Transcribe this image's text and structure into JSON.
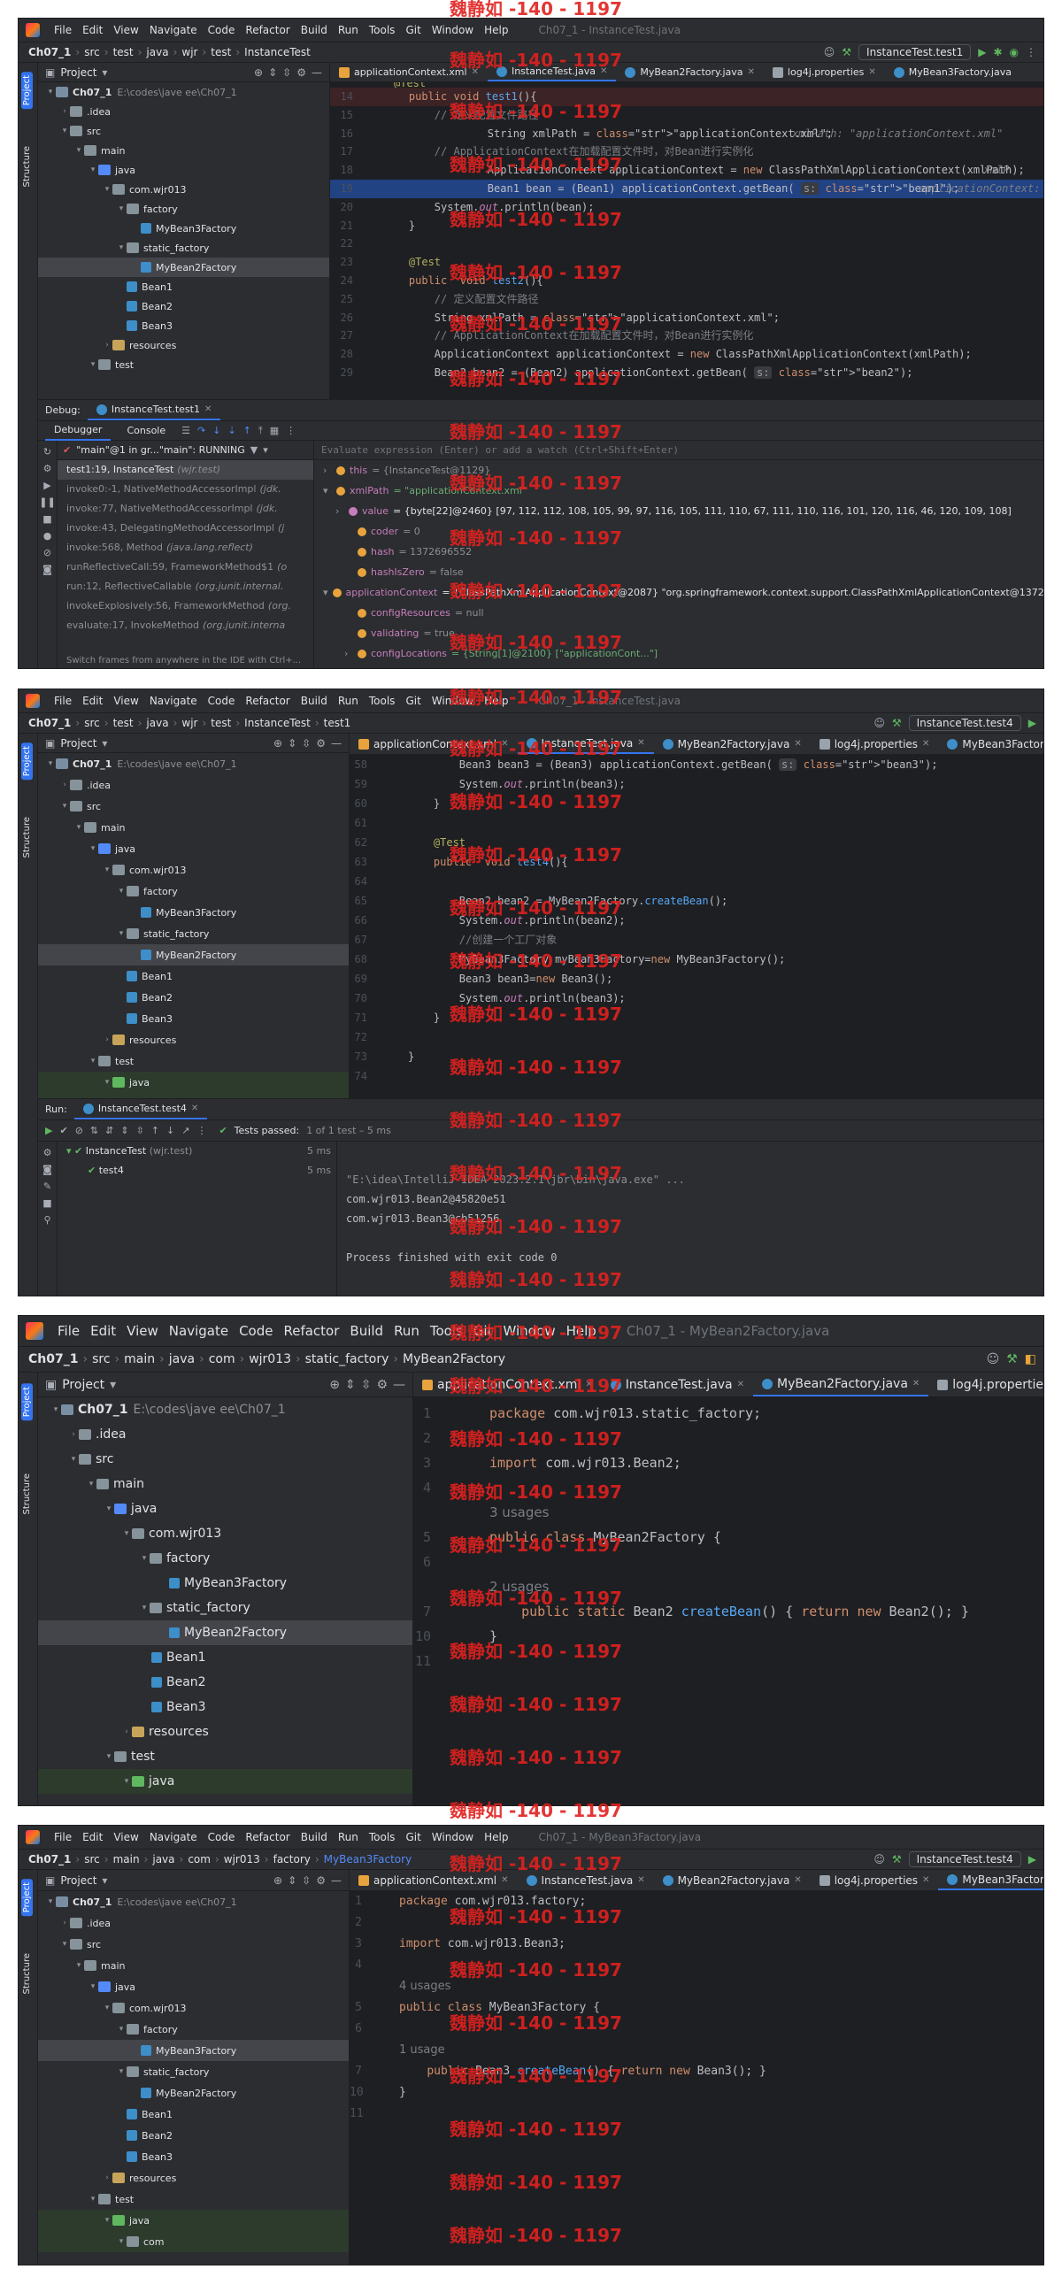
{
  "menu": [
    "File",
    "Edit",
    "View",
    "Navigate",
    "Code",
    "Refactor",
    "Build",
    "Run",
    "Tools",
    "Git",
    "Window",
    "Help"
  ],
  "watermark": "魏静如 -140 - 1197",
  "project_header": "Project",
  "strip_labels": {
    "project": "Project",
    "structure": "Structure",
    "bookmarks": "Bookmarks"
  },
  "tree_labels": {
    "root": "Ch07_1",
    "root_path": "E:\\codes\\jave ee\\Ch07_1",
    "idea": ".idea",
    "src": "src",
    "main": "main",
    "java": "java",
    "pkg": "com.wjr013",
    "factory": "factory",
    "mb3": "MyBean3Factory",
    "static_factory": "static_factory",
    "mb2": "MyBean2Factory",
    "bean1": "Bean1",
    "bean2": "Bean2",
    "bean3": "Bean3",
    "resources": "resources",
    "test": "test",
    "com": "com"
  },
  "tabs": {
    "ctx": "applicationContext.xml",
    "it": "InstanceTest.java",
    "mb2": "MyBean2Factory.java",
    "log4j": "log4j.properties",
    "mb3": "MyBean3Factory.java"
  },
  "panel1": {
    "title": "Ch07_1 - InstanceTest.java",
    "crumbs": [
      "Ch07_1",
      "src",
      "test",
      "java",
      "wjr",
      "test",
      "InstanceTest"
    ],
    "runcfg": "InstanceTest.test1",
    "lines": [
      {
        "n": "14",
        "t": "    public void test1(){"
      },
      {
        "n": "15",
        "t": "        // 定义配置文件路径"
      },
      {
        "n": "16",
        "t": "        String xmlPath = \"applicationContext.xml\";",
        "h": "xmlPath: \"applicationContext.xml\""
      },
      {
        "n": "17",
        "t": "        // ApplicationContext在加载配置文件时，对Bean进行实例化"
      },
      {
        "n": "18",
        "t": "        ApplicationContext applicationContext = new ClassPathXmlApplicationContext(xmlPath);",
        "h": "xmlP"
      },
      {
        "n": "19",
        "t": "        Bean1 bean = (Bean1) applicationContext.getBean( s: \"bean1\");",
        "h": "applicationContext: \"org.spr"
      },
      {
        "n": "20",
        "t": "        System.out.println(bean);"
      },
      {
        "n": "21",
        "t": "    }"
      },
      {
        "n": "22",
        "t": ""
      },
      {
        "n": "23",
        "t": "    @Test"
      },
      {
        "n": "24",
        "t": "    public  void test2(){"
      },
      {
        "n": "25",
        "t": "        // 定义配置文件路径"
      },
      {
        "n": "26",
        "t": "        String xmlPath = \"applicationContext.xml\";"
      },
      {
        "n": "27",
        "t": "        // ApplicationContext在加载配置文件时，对Bean进行实例化"
      },
      {
        "n": "28",
        "t": "        ApplicationContext applicationContext = new ClassPathXmlApplicationContext(xmlPath);"
      },
      {
        "n": "29",
        "t": "        Bean2 bean2 = (Bean2) applicationContext.getBean( s: \"bean2\");"
      }
    ],
    "test_anno": "@Test",
    "debug_label": "Debug:",
    "debug_tab": "InstanceTest.test1",
    "debugger": "Debugger",
    "console": "Console",
    "thread": "\"main\"@1 in gr...\"main\": RUNNING",
    "eval": "Evaluate expression (Enter) or add a watch (Ctrl+Shift+Enter)",
    "frames": [
      {
        "t": "test1:19, InstanceTest",
        "c": "(wjr.test)"
      },
      {
        "t": "invoke0:-1, NativeMethodAccessorImpl",
        "c": "(jdk."
      },
      {
        "t": "invoke:77, NativeMethodAccessorImpl",
        "c": "(jdk."
      },
      {
        "t": "invoke:43, DelegatingMethodAccessorImpl",
        "c": "(j"
      },
      {
        "t": "invoke:568, Method",
        "c": "(java.lang.reflect)"
      },
      {
        "t": "runReflectiveCall:59, FrameworkMethod$1",
        "c": "(o"
      },
      {
        "t": "run:12, ReflectiveCallable",
        "c": "(org.junit.internal."
      },
      {
        "t": "invokeExplosively:56, FrameworkMethod",
        "c": "(org."
      },
      {
        "t": "evaluate:17, InvokeMethod",
        "c": "(org.junit.interna"
      }
    ],
    "frames_hint": "Switch frames from anywhere in the IDE with Ctrl+...",
    "vars": [
      {
        "n": "this",
        "v": "= {InstanceTest@1129}"
      },
      {
        "n": "xmlPath",
        "v": "= \"applicationContext.xml\""
      },
      {
        "n": "value",
        "v": "= {byte[22]@2460} [97, 112, 112, 108, 105, 99, 97, 116, 105, 111, 110, 67, 111, 110, 116, 101, 120, 116, 46, 120, 109, 108]"
      },
      {
        "n": "coder",
        "v": "= 0"
      },
      {
        "n": "hash",
        "v": "= 1372696552"
      },
      {
        "n": "hashIsZero",
        "v": "= false"
      },
      {
        "n": "applicationContext",
        "v": "= {ClassPathXmlApplicationContext@2087} \"org.springframework.context.support.ClassPathXmlApplicationContext@1372ed"
      },
      {
        "n": "configResources",
        "v": "= null"
      },
      {
        "n": "validating",
        "v": "= true"
      },
      {
        "n": "configLocations",
        "v": "= {String[1]@2100} [\"applicationCont...\"]"
      }
    ]
  },
  "panel2": {
    "title": "Ch07_1 - InstanceTest.java",
    "crumbs": [
      "Ch07_1",
      "src",
      "test",
      "java",
      "wjr",
      "test",
      "InstanceTest",
      "test1"
    ],
    "runcfg": "InstanceTest.test4",
    "lines": [
      {
        "n": "58",
        "t": "        Bean3 bean3 = (Bean3) applicationContext.getBean( s: \"bean3\");"
      },
      {
        "n": "59",
        "t": "        System.out.println(bean3);"
      },
      {
        "n": "60",
        "t": "    }"
      },
      {
        "n": "61",
        "t": ""
      },
      {
        "n": "62",
        "t": "    @Test"
      },
      {
        "n": "63",
        "t": "    public  void test4(){"
      },
      {
        "n": "64",
        "t": ""
      },
      {
        "n": "65",
        "t": "        Bean2 bean2 = MyBean2Factory.createBean();"
      },
      {
        "n": "66",
        "t": "        System.out.println(bean2);"
      },
      {
        "n": "67",
        "t": "        //创建一个工厂对象"
      },
      {
        "n": "68",
        "t": "        MyBean3Factory myBean3Factory=new MyBean3Factory();"
      },
      {
        "n": "69",
        "t": "        Bean3 bean3=new Bean3();"
      },
      {
        "n": "70",
        "t": "        System.out.println(bean3);"
      },
      {
        "n": "71",
        "t": "    }"
      },
      {
        "n": "72",
        "t": ""
      },
      {
        "n": "73",
        "t": "}"
      },
      {
        "n": "74",
        "t": ""
      }
    ],
    "run_label": "Run:",
    "run_tab": "InstanceTest.test4",
    "passed": "Tests passed:",
    "passed_detail": "1 of 1 test – 5 ms",
    "tests": [
      {
        "t": "InstanceTest",
        "c": "(wjr.test)",
        "ms": "5 ms"
      },
      {
        "t": "test4",
        "c": "",
        "ms": "5 ms"
      }
    ],
    "console": [
      "\"E:\\idea\\IntelliJ IDEA 2023.2.1\\jbr\\bin\\java.exe\" ...",
      "com.wjr013.Bean2@45820e51",
      "com.wjr013.Bean3@cb51256",
      "",
      "Process finished with exit code 0"
    ]
  },
  "panel3": {
    "title": "Ch07_1 - MyBean2Factory.java",
    "crumbs": [
      "Ch07_1",
      "src",
      "main",
      "java",
      "com",
      "wjr013",
      "static_factory",
      "MyBean2Factory"
    ],
    "lines": [
      {
        "n": "1",
        "t": "package com.wjr013.static_factory;"
      },
      {
        "n": "2",
        "t": ""
      },
      {
        "n": "3",
        "t": "import com.wjr013.Bean2;"
      },
      {
        "n": "4",
        "t": ""
      },
      {
        "n": "",
        "t": "3 usages",
        "u": true
      },
      {
        "n": "5",
        "t": "public class MyBean2Factory {"
      },
      {
        "n": "6",
        "t": ""
      },
      {
        "n": "",
        "t": "2 usages",
        "u": true
      },
      {
        "n": "7",
        "t": "    public static Bean2 createBean() { return new Bean2(); }"
      },
      {
        "n": "10",
        "t": "}"
      },
      {
        "n": "11",
        "t": ""
      }
    ]
  },
  "panel4": {
    "title": "Ch07_1 - MyBean3Factory.java",
    "crumbs": [
      "Ch07_1",
      "src",
      "main",
      "java",
      "com",
      "wjr013",
      "factory",
      "MyBean3Factory"
    ],
    "runcfg": "InstanceTest.test4",
    "lines": [
      {
        "n": "1",
        "t": "package com.wjr013.factory;"
      },
      {
        "n": "2",
        "t": ""
      },
      {
        "n": "3",
        "t": "import com.wjr013.Bean3;"
      },
      {
        "n": "4",
        "t": ""
      },
      {
        "n": "",
        "t": "4 usages",
        "u": true
      },
      {
        "n": "5",
        "t": "public class MyBean3Factory {"
      },
      {
        "n": "6",
        "t": ""
      },
      {
        "n": "",
        "t": "1 usage",
        "u": true
      },
      {
        "n": "7",
        "t": "    public Bean3 createBean() { return new Bean3(); }"
      },
      {
        "n": "10",
        "t": "}"
      },
      {
        "n": "11",
        "t": ""
      }
    ]
  }
}
